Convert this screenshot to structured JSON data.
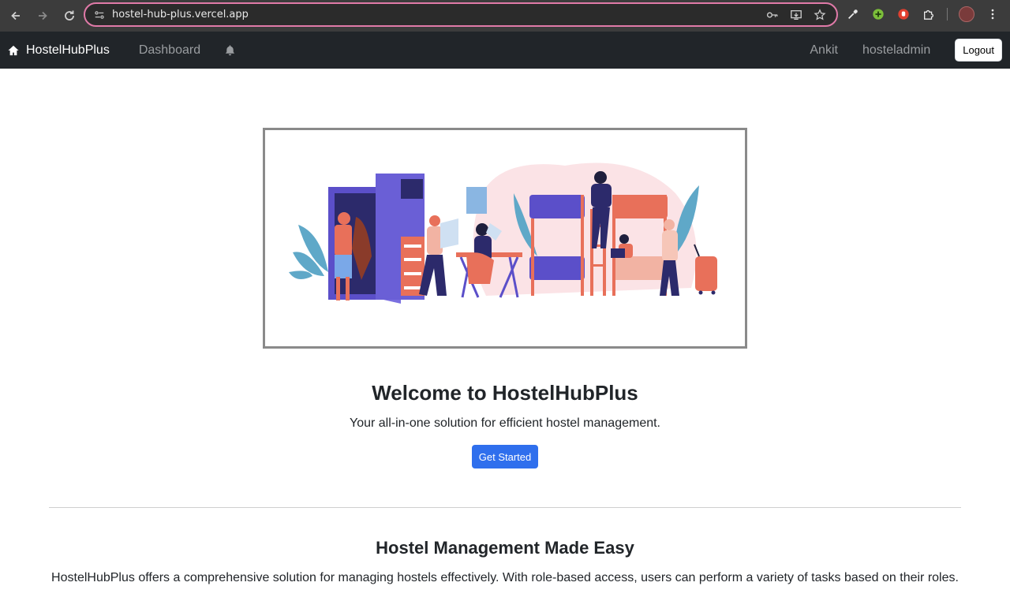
{
  "browser": {
    "url": "hostel-hub-plus.vercel.app",
    "icons": [
      "back-icon",
      "forward-icon",
      "reload-icon",
      "site-settings-icon",
      "password-key-icon",
      "install-app-icon",
      "bookmark-star-icon",
      "eyedropper-extension-icon",
      "green-plus-extension-icon",
      "red-hand-extension-icon",
      "extensions-puzzle-icon",
      "profile-avatar",
      "menu-kebab-icon"
    ]
  },
  "navbar": {
    "brand": "HostelHubPlus",
    "dashboard": "Dashboard",
    "user_name": "Ankit",
    "role": "hosteladmin",
    "logout": "Logout"
  },
  "hero": {
    "title": "Welcome to HostelHubPlus",
    "tagline": "Your all-in-one solution for efficient hostel management.",
    "cta": "Get Started"
  },
  "about": {
    "title": "Hostel Management Made Easy",
    "text": "HostelHubPlus offers a comprehensive solution for managing hostels effectively. With role-based access, users can perform a variety of tasks based on their roles."
  },
  "colors": {
    "navbar_bg": "#212529",
    "primary": "#2f6fed",
    "omnibox_border": "#e07aa8"
  }
}
